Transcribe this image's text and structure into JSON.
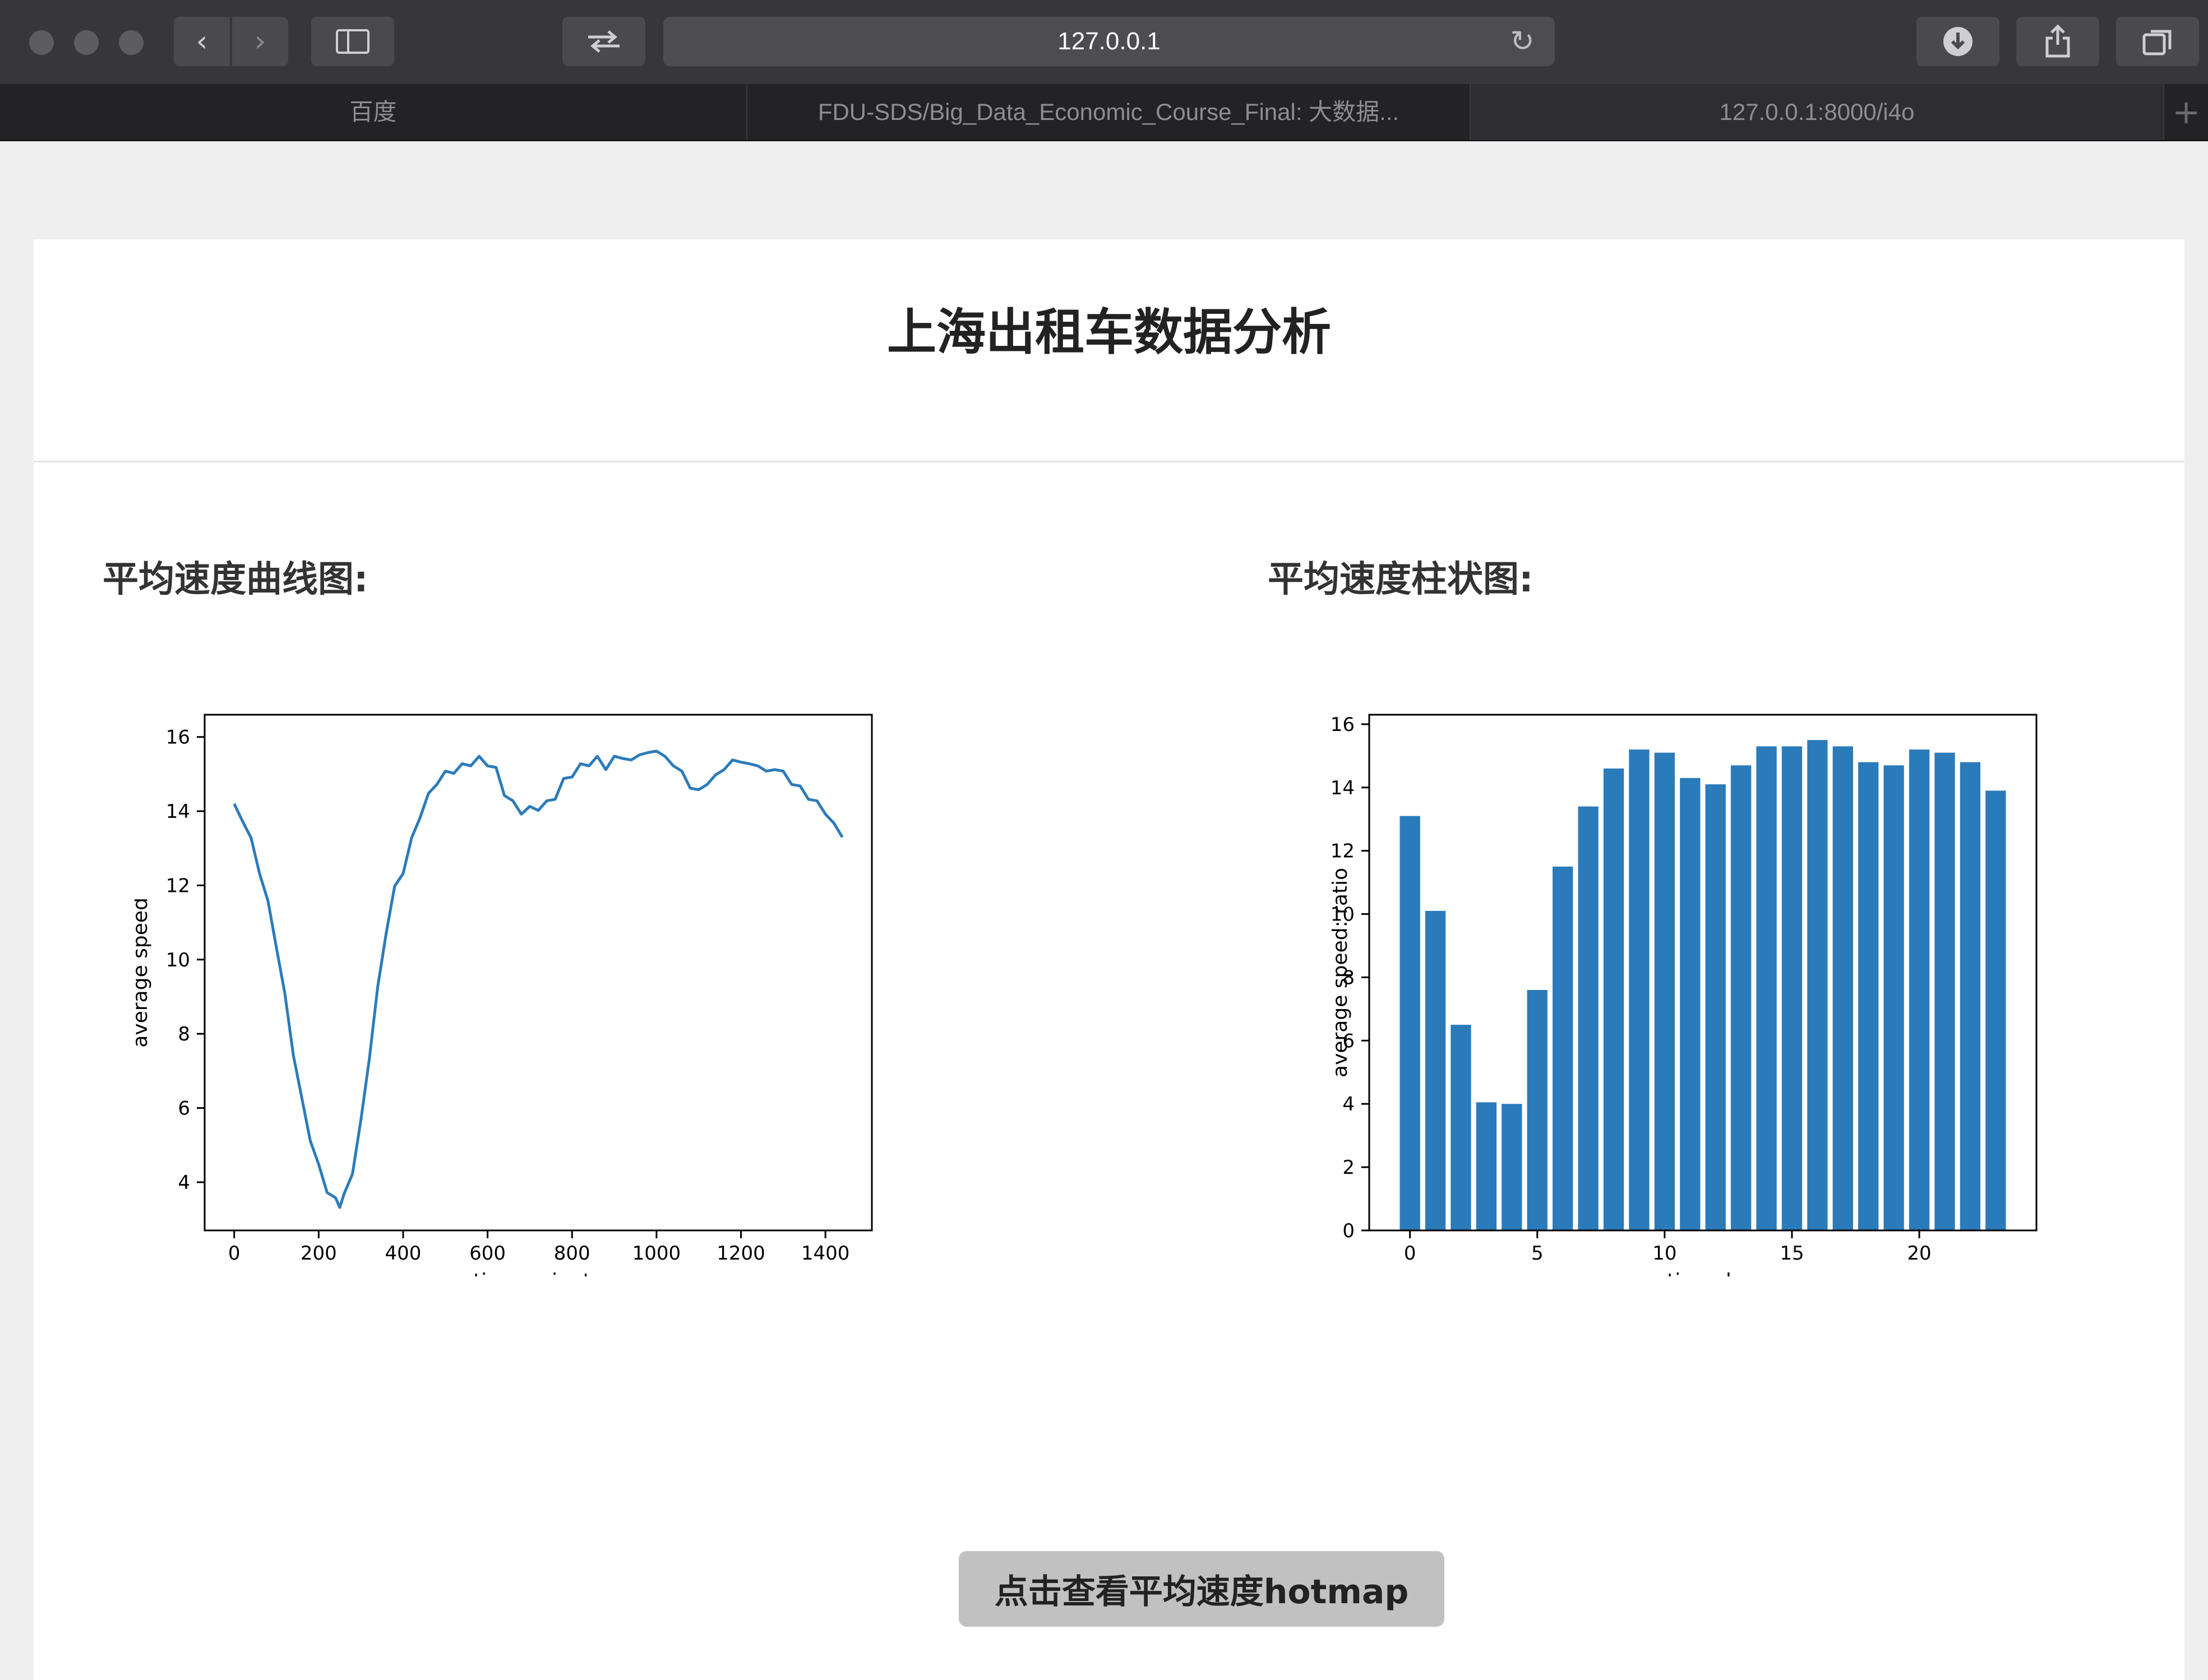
{
  "browser": {
    "address": "127.0.0.1",
    "tabs": [
      {
        "label": "百度"
      },
      {
        "label": "FDU-SDS/Big_Data_Economic_Course_Final: 大数据..."
      },
      {
        "label": "127.0.0.1:8000/i4o"
      }
    ]
  },
  "page": {
    "title": "上海出租车数据分析",
    "line_section_title": "平均速度曲线图:",
    "bar_section_title": "平均速度柱状图:",
    "hotmap_button": "点击查看平均速度hotmap"
  },
  "colors": {
    "series": "#2b7bba"
  },
  "chart_data": [
    {
      "type": "line",
      "xlabel": "time: minute",
      "ylabel": "average speed",
      "xlim": [
        -70,
        1510
      ],
      "ylim": [
        2.7,
        16.6
      ],
      "xticks": [
        0,
        200,
        400,
        600,
        800,
        1000,
        1200,
        1400
      ],
      "yticks": [
        4,
        6,
        8,
        10,
        12,
        14,
        16
      ],
      "grid": false,
      "series": [
        {
          "x": [
            0,
            20,
            40,
            60,
            80,
            100,
            120,
            140,
            160,
            180,
            200,
            220,
            240,
            250,
            260,
            280,
            300,
            320,
            340,
            360,
            380,
            400,
            420,
            440,
            460,
            480,
            500,
            520,
            540,
            560,
            580,
            600,
            620,
            640,
            660,
            680,
            700,
            720,
            740,
            760,
            780,
            800,
            820,
            840,
            860,
            880,
            900,
            920,
            940,
            960,
            980,
            1000,
            1020,
            1040,
            1060,
            1080,
            1100,
            1120,
            1140,
            1160,
            1180,
            1200,
            1220,
            1240,
            1260,
            1280,
            1300,
            1320,
            1340,
            1360,
            1380,
            1400,
            1420,
            1440
          ],
          "y": [
            14.2,
            13.8,
            13.2,
            12.4,
            11.5,
            10.4,
            9.0,
            7.5,
            6.2,
            5.2,
            4.4,
            3.8,
            3.5,
            3.4,
            3.6,
            4.3,
            5.6,
            7.4,
            9.2,
            10.8,
            11.9,
            12.4,
            13.2,
            13.9,
            14.4,
            14.8,
            15.0,
            15.1,
            15.2,
            15.3,
            15.4,
            15.3,
            15.1,
            14.5,
            14.2,
            14.0,
            14.05,
            14.1,
            14.2,
            14.4,
            14.8,
            15.0,
            15.2,
            15.3,
            15.4,
            15.2,
            15.4,
            15.5,
            15.3,
            15.6,
            15.5,
            15.7,
            15.4,
            15.3,
            15.0,
            14.7,
            14.5,
            14.8,
            14.9,
            15.2,
            15.3,
            15.4,
            15.2,
            15.3,
            15.0,
            15.2,
            15.0,
            14.8,
            14.6,
            14.4,
            14.2,
            14.0,
            13.6,
            13.3
          ]
        }
      ]
    },
    {
      "type": "bar",
      "xlabel": "time: h",
      "ylabel": "average speed: ratio",
      "xlim": [
        -1.6,
        24.6
      ],
      "ylim": [
        0,
        16.3
      ],
      "xticks": [
        0,
        5,
        10,
        15,
        20
      ],
      "yticks": [
        0,
        2,
        4,
        6,
        8,
        10,
        12,
        14,
        16
      ],
      "grid": false,
      "categories": [
        0,
        1,
        2,
        3,
        4,
        5,
        6,
        7,
        8,
        9,
        10,
        11,
        12,
        13,
        14,
        15,
        16,
        17,
        18,
        19,
        20,
        21,
        22,
        23
      ],
      "values": [
        13.1,
        10.1,
        6.5,
        4.05,
        4.0,
        7.6,
        11.5,
        13.4,
        14.6,
        15.2,
        15.1,
        14.3,
        14.1,
        14.7,
        15.3,
        15.3,
        15.5,
        15.3,
        14.8,
        14.7,
        15.2,
        15.1,
        14.8,
        13.9
      ]
    }
  ]
}
